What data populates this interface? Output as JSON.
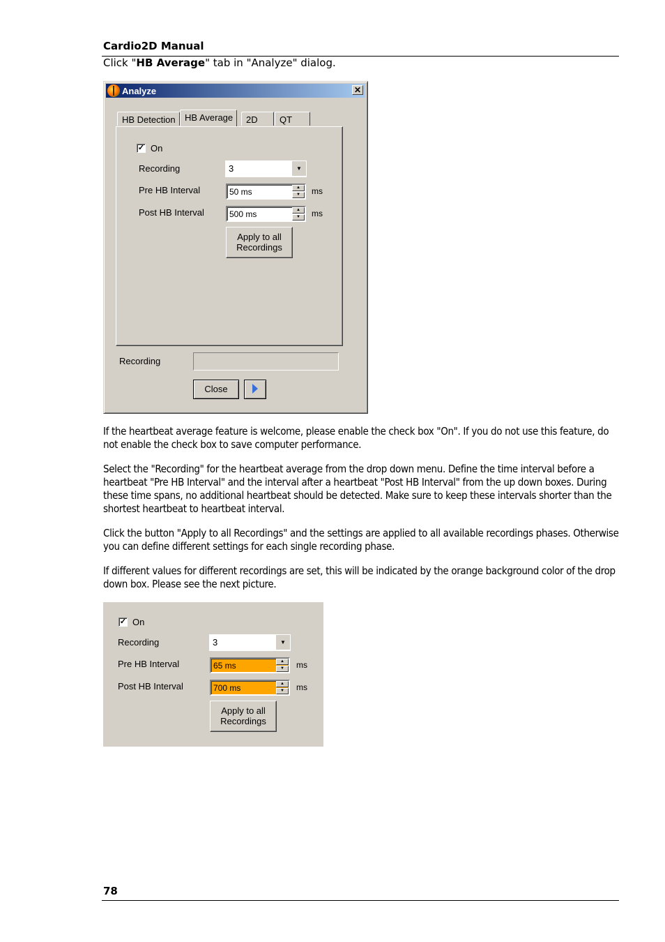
{
  "header": {
    "title": "Cardio2D Manual"
  },
  "intro": {
    "prefix": "Click \"",
    "bold": "HB Average",
    "suffix": "\" tab in \"Analyze\" dialog."
  },
  "dialog": {
    "title": "Analyze",
    "icon": "app-logo-icon",
    "close_glyph": "✕",
    "tabs": [
      {
        "label": "HB Detection",
        "active": false
      },
      {
        "label": "HB Average",
        "active": true
      },
      {
        "label": "2D",
        "active": false
      },
      {
        "label": "QT",
        "active": false
      }
    ],
    "on_checkbox": {
      "label": "On",
      "checked": true,
      "glyph": "✓"
    },
    "recording": {
      "label": "Recording",
      "value": "3",
      "arrow": "▼"
    },
    "pre_hb": {
      "label": "Pre HB Interval",
      "value": "50 ms",
      "unit": "ms"
    },
    "post_hb": {
      "label": "Post HB Interval",
      "value": "500 ms",
      "unit": "ms"
    },
    "apply_button": {
      "line1": "Apply to all",
      "line2": "Recordings"
    },
    "footer_recording": {
      "label": "Recording",
      "value": ""
    },
    "close_button": "Close",
    "play_button": "play-icon"
  },
  "paragraphs": [
    "If the heartbeat average feature is welcome, please enable the check box \"On\". If you do not use this feature, do not enable the check box to save computer performance.",
    "Select the \"Recording\" for the heartbeat average from the drop down menu. Define the time interval before a heartbeat \"Pre HB Interval\" and the interval after a heartbeat \"Post HB Interval\" from the up down boxes. During these time spans, no additional heartbeat should be detected. Make sure to keep these intervals shorter than the shortest heartbeat to heartbeat interval.",
    "Click the button \"Apply to all Recordings\" and the settings are applied to all available recordings phases. Otherwise you can define different settings for each single recording phase.",
    "If different values for different recordings are set, this will be indicated by the orange background color of the drop down box. Please see the next picture."
  ],
  "panel2": {
    "on_checkbox": {
      "label": "On",
      "checked": true,
      "glyph": "✓"
    },
    "recording": {
      "label": "Recording",
      "value": "3",
      "arrow": "▼"
    },
    "pre_hb": {
      "label": "Pre HB Interval",
      "value": "65 ms",
      "unit": "ms"
    },
    "post_hb": {
      "label": "Post HB Interval",
      "value": "700 ms",
      "unit": "ms"
    },
    "apply_button": {
      "line1": "Apply to all",
      "line2": "Recordings"
    },
    "highlight_color": "#ffa500"
  },
  "footer": {
    "page_number": "78"
  }
}
